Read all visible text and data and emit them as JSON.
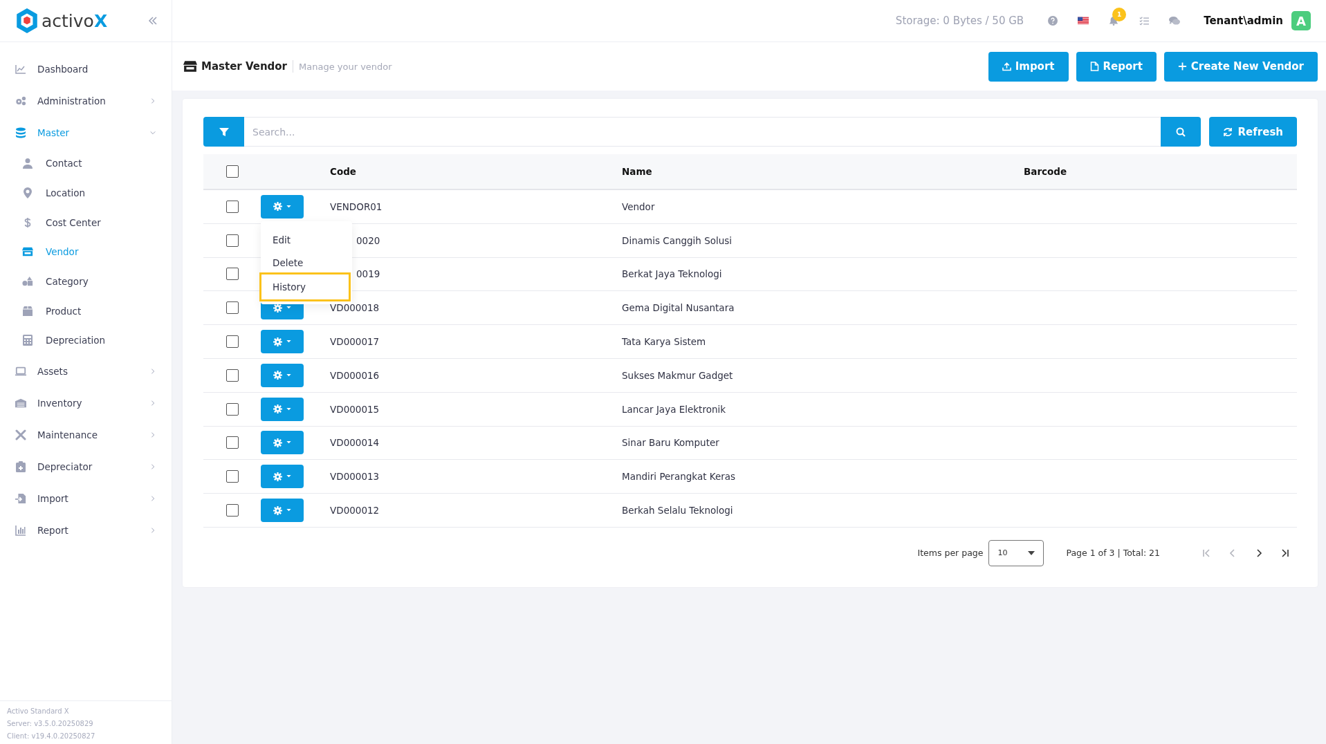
{
  "brand": {
    "name": "activo",
    "accent": "X"
  },
  "sidebar": {
    "items": [
      {
        "label": "Dashboard",
        "selected": false
      },
      {
        "label": "Administration",
        "selected": false,
        "expanded": false
      },
      {
        "label": "Master",
        "selected": true,
        "expanded": true,
        "children": [
          {
            "label": "Contact",
            "selected": false
          },
          {
            "label": "Location",
            "selected": false
          },
          {
            "label": "Cost Center",
            "selected": false
          },
          {
            "label": "Vendor",
            "selected": true
          },
          {
            "label": "Category",
            "selected": false
          },
          {
            "label": "Product",
            "selected": false
          },
          {
            "label": "Depreciation",
            "selected": false
          }
        ]
      },
      {
        "label": "Assets",
        "selected": false,
        "expanded": false
      },
      {
        "label": "Inventory",
        "selected": false,
        "expanded": false
      },
      {
        "label": "Maintenance",
        "selected": false,
        "expanded": false
      },
      {
        "label": "Depreciator",
        "selected": false,
        "expanded": false
      },
      {
        "label": "Import",
        "selected": false,
        "expanded": false
      },
      {
        "label": "Report",
        "selected": false,
        "expanded": false
      }
    ],
    "footer": [
      "Activo Standard X",
      "Server: v3.5.0.20250829",
      "Client: v19.4.0.20250827"
    ]
  },
  "topbar": {
    "storage": "Storage: 0 Bytes / 50 GB",
    "notification_count": "1",
    "user": "Tenant\\admin",
    "avatar": "A"
  },
  "page": {
    "title": "Master Vendor",
    "subtitle": "Manage your vendor",
    "buttons": [
      "Import",
      "Report",
      "Create New Vendor"
    ]
  },
  "search": {
    "placeholder": "Search...",
    "refresh": "Refresh"
  },
  "table": {
    "select_all_checked": false,
    "columns": [
      "Code",
      "Name",
      "Barcode"
    ],
    "rows": [
      {
        "checked": false,
        "code": "VENDOR01",
        "name": "Vendor",
        "covered": false
      },
      {
        "checked": false,
        "code": "0020",
        "name": "Dinamis Canggih Solusi",
        "covered": true
      },
      {
        "checked": false,
        "code": "0019",
        "name": "Berkat Jaya Teknologi",
        "covered": true
      },
      {
        "checked": false,
        "code": "VD000018",
        "name": "Gema Digital Nusantara",
        "covered": false
      },
      {
        "checked": false,
        "code": "VD000017",
        "name": "Tata Karya Sistem",
        "covered": false
      },
      {
        "checked": false,
        "code": "VD000016",
        "name": "Sukses Makmur Gadget",
        "covered": false
      },
      {
        "checked": false,
        "code": "VD000015",
        "name": "Lancar Jaya Elektronik",
        "covered": false
      },
      {
        "checked": false,
        "code": "VD000014",
        "name": "Sinar Baru Komputer",
        "covered": false
      },
      {
        "checked": false,
        "code": "VD000013",
        "name": "Mandiri Perangkat Keras",
        "covered": false
      },
      {
        "checked": false,
        "code": "VD000012",
        "name": "Berkah Selalu Teknologi",
        "covered": false
      }
    ],
    "action_menu": {
      "items": [
        {
          "label": "Edit",
          "highlighted": false
        },
        {
          "label": "Delete",
          "highlighted": false
        },
        {
          "label": "History",
          "highlighted": true
        }
      ]
    }
  },
  "pagination": {
    "items_per_page_label": "Items per page",
    "page_size": "10",
    "summary": "Page 1 of 3 | Total: 21",
    "nav": [
      {
        "kind": "first",
        "disabled": true
      },
      {
        "kind": "prev",
        "disabled": true
      },
      {
        "kind": "next",
        "disabled": false
      },
      {
        "kind": "last",
        "disabled": false
      }
    ]
  }
}
